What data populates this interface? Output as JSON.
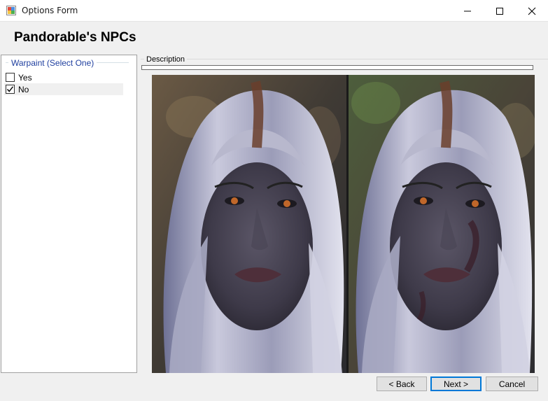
{
  "window": {
    "title": "Options Form"
  },
  "header": {
    "title": "Pandorable's NPCs"
  },
  "group": {
    "title": "Warpaint (Select One)",
    "options": [
      {
        "label": "Yes",
        "checked": false
      },
      {
        "label": "No",
        "checked": true
      }
    ]
  },
  "description": {
    "label": "Description",
    "text": ""
  },
  "buttons": {
    "back": "< Back",
    "next": "Next >",
    "cancel": "Cancel"
  },
  "colors": {
    "group_title": "#1f3f9f",
    "next_border": "#0078d7"
  }
}
